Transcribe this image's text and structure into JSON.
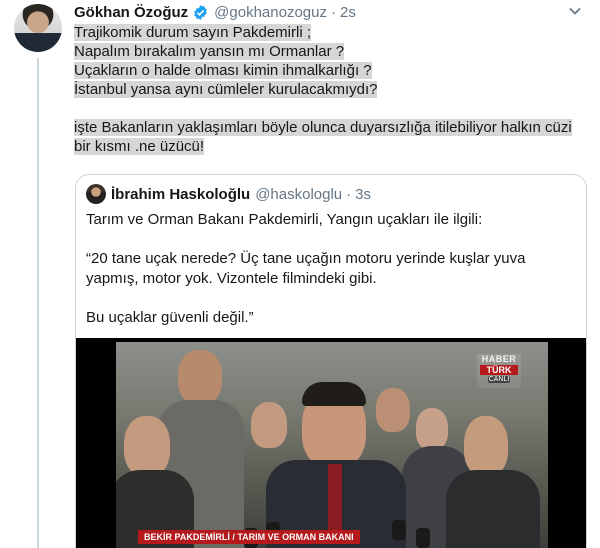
{
  "tweet": {
    "author_name": "Gökhan Özoğuz",
    "handle": "@gokhanozoguz",
    "separator": "·",
    "time": "2s",
    "lines": [
      "Trajikomik durum sayın Pakdemirli ;",
      "Napalım bırakalım yansın mı Ormanlar ?",
      "Uçakların o halde olması kimin ihmalkarlığı ?",
      "İstanbul yansa aynı cümleler kurulacakmıydı?"
    ],
    "lines2": [
      "işte Bakanların yaklaşımları böyle olunca duyarsızlığa itilebiliyor halkın cüzi",
      "bir kısmı .ne üzücü!"
    ]
  },
  "quote": {
    "author_name": "İbrahim Haskoloğlu",
    "handle": "@haskologlu",
    "separator": "·",
    "time": "3s",
    "paragraph1": "Tarım ve Orman Bakanı Pakdemirli, Yangın uçakları ile ilgili:",
    "paragraph2_lines": [
      "“20 tane uçak nerede? Üç tane uçağın motoru yerinde kuşlar yuva",
      "yapmış, motor yok. Vizontele filmindeki gibi."
    ],
    "paragraph3": "Bu uçaklar güvenli değil.”"
  },
  "video": {
    "channel_line1": "HABER",
    "channel_line2": "TÜRK",
    "channel_line3": "CANLI",
    "lower_third": "BEKİR PAKDEMİRLİ / TARIM VE ORMAN BAKANI"
  },
  "colors": {
    "verified": "#1da1f2",
    "secondary_text": "#657786",
    "highlight": "#d6d6d6",
    "channel_red": "#b4191c"
  }
}
